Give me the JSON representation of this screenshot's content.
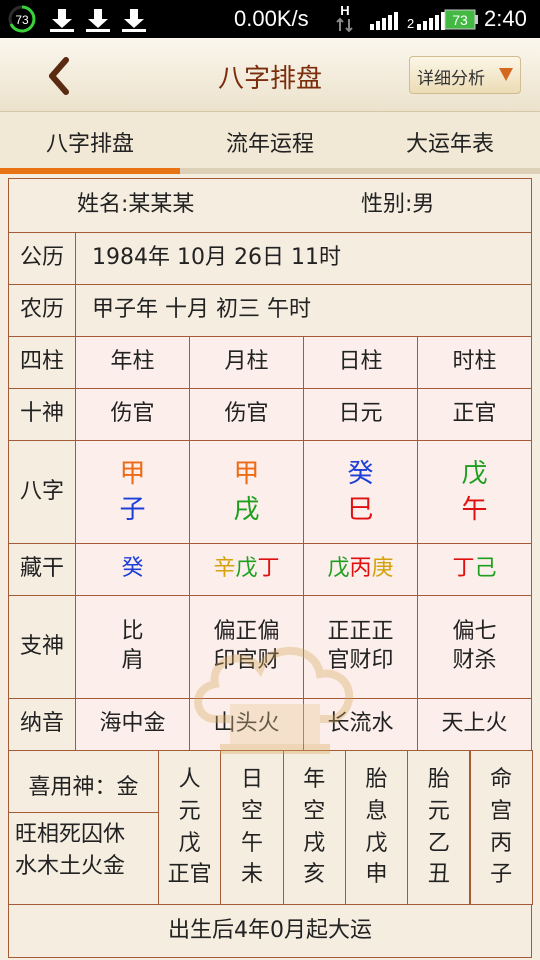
{
  "status_bar": {
    "notif_count": "73",
    "speed": "0.00K/s",
    "net_letter": "H",
    "sim2": "2",
    "battery": "73",
    "time": "2:40"
  },
  "header": {
    "title": "八字排盘",
    "detail_button": "详细分析"
  },
  "tabs": [
    {
      "label": "八字排盘",
      "active": true
    },
    {
      "label": "流年运程"
    },
    {
      "label": "大运年表"
    }
  ],
  "person": {
    "name": "姓名:某某某",
    "gender": "性别:男"
  },
  "calendar": {
    "solar_label": "公历",
    "solar": "1984年 10月 26日 11时",
    "lunar_label": "农历",
    "lunar": "甲子年 十月 初三 午时"
  },
  "pillars": {
    "header_label": "四柱",
    "headers": [
      "年柱",
      "月柱",
      "日柱",
      "时柱"
    ],
    "shishen_label": "十神",
    "shishen": [
      "伤官",
      "伤官",
      "日元",
      "正官"
    ],
    "bazi_label": "八字",
    "stems": [
      "甲",
      "甲",
      "癸",
      "戊"
    ],
    "branches": [
      "子",
      "戌",
      "巳",
      "午"
    ],
    "canggan_label": "藏干",
    "canggan": [
      [
        {
          "t": "癸",
          "c": "blue"
        }
      ],
      [
        {
          "t": "辛",
          "c": "yellow"
        },
        {
          "t": "戊",
          "c": "green"
        },
        {
          "t": "丁",
          "c": "red"
        }
      ],
      [
        {
          "t": "戊",
          "c": "green"
        },
        {
          "t": "丙",
          "c": "red"
        },
        {
          "t": "庚",
          "c": "yellow"
        }
      ],
      [
        {
          "t": "丁",
          "c": "red"
        },
        {
          "t": "己",
          "c": "green"
        }
      ]
    ],
    "zhishen_label": "支神",
    "zhishen": [
      [
        "比",
        "肩"
      ],
      [
        "偏正偏",
        "印官财"
      ],
      [
        "正正正",
        "官财印"
      ],
      [
        "偏七",
        "财杀"
      ]
    ],
    "nayin_label": "纳音",
    "nayin": [
      "海中金",
      "山头火",
      "长流水",
      "天上火"
    ]
  },
  "bottom": {
    "xiyongshen": "喜用神：金",
    "wangxiang_1": "旺相死囚休",
    "wangxiang_2": "水木土火金",
    "columns": [
      {
        "l1": "人",
        "l2": "元",
        "l3": "戊",
        "l4": "正官"
      },
      {
        "l1": "日",
        "l2": "空",
        "l3": "午",
        "l4": "未"
      },
      {
        "l1": "年",
        "l2": "空",
        "l3": "戌",
        "l4": "亥"
      },
      {
        "l1": "胎",
        "l2": "息",
        "l3": "戊",
        "l4": "申"
      },
      {
        "l1": "胎",
        "l2": "元",
        "l3": "乙",
        "l4": "丑"
      },
      {
        "l1": "命",
        "l2": "宫",
        "l3": "丙",
        "l4": "子"
      }
    ],
    "dayun_start": "出生后4年0月起大运"
  },
  "colors": {
    "stem_colors": [
      "orange",
      "orange",
      "blue",
      "green"
    ],
    "branch_colors": [
      "blue",
      "green",
      "red",
      "red"
    ],
    "border": "#a35b38",
    "title": "#7b2d0c",
    "tab_active": "#e87314"
  }
}
